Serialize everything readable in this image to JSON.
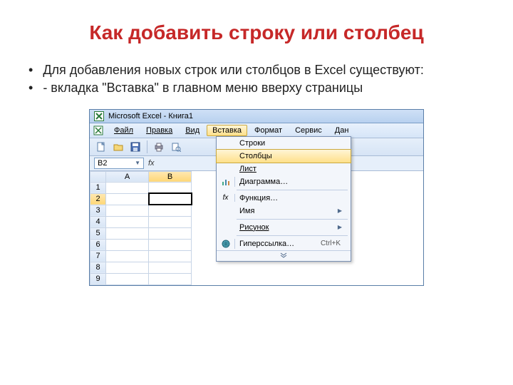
{
  "slide": {
    "title": "Как добавить строку или столбец",
    "bullet1": "Для добавления новых строк или столбцов в Excel существуют:",
    "bullet2": "- вкладка \"Вставка\" в главном меню вверху страницы"
  },
  "excel": {
    "title": "Microsoft Excel - Книга1",
    "menu": {
      "file": "Файл",
      "edit": "Правка",
      "view": "Вид",
      "insert": "Вставка",
      "format": "Формат",
      "tools": "Сервис",
      "data": "Дан"
    },
    "name_box": "B2",
    "fx": "fx",
    "cols": {
      "A": "A",
      "B": "B"
    },
    "rows": [
      "1",
      "2",
      "3",
      "4",
      "5",
      "6",
      "7",
      "8",
      "9"
    ],
    "dropdown": {
      "rows": "Строки",
      "columns": "Столбцы",
      "sheet": "Лист",
      "chart": "Диаграмма…",
      "function": "Функция…",
      "name": "Имя",
      "picture": "Рисунок",
      "hyperlink": "Гиперссылка…",
      "hyperlink_shortcut": "Ctrl+K"
    }
  }
}
